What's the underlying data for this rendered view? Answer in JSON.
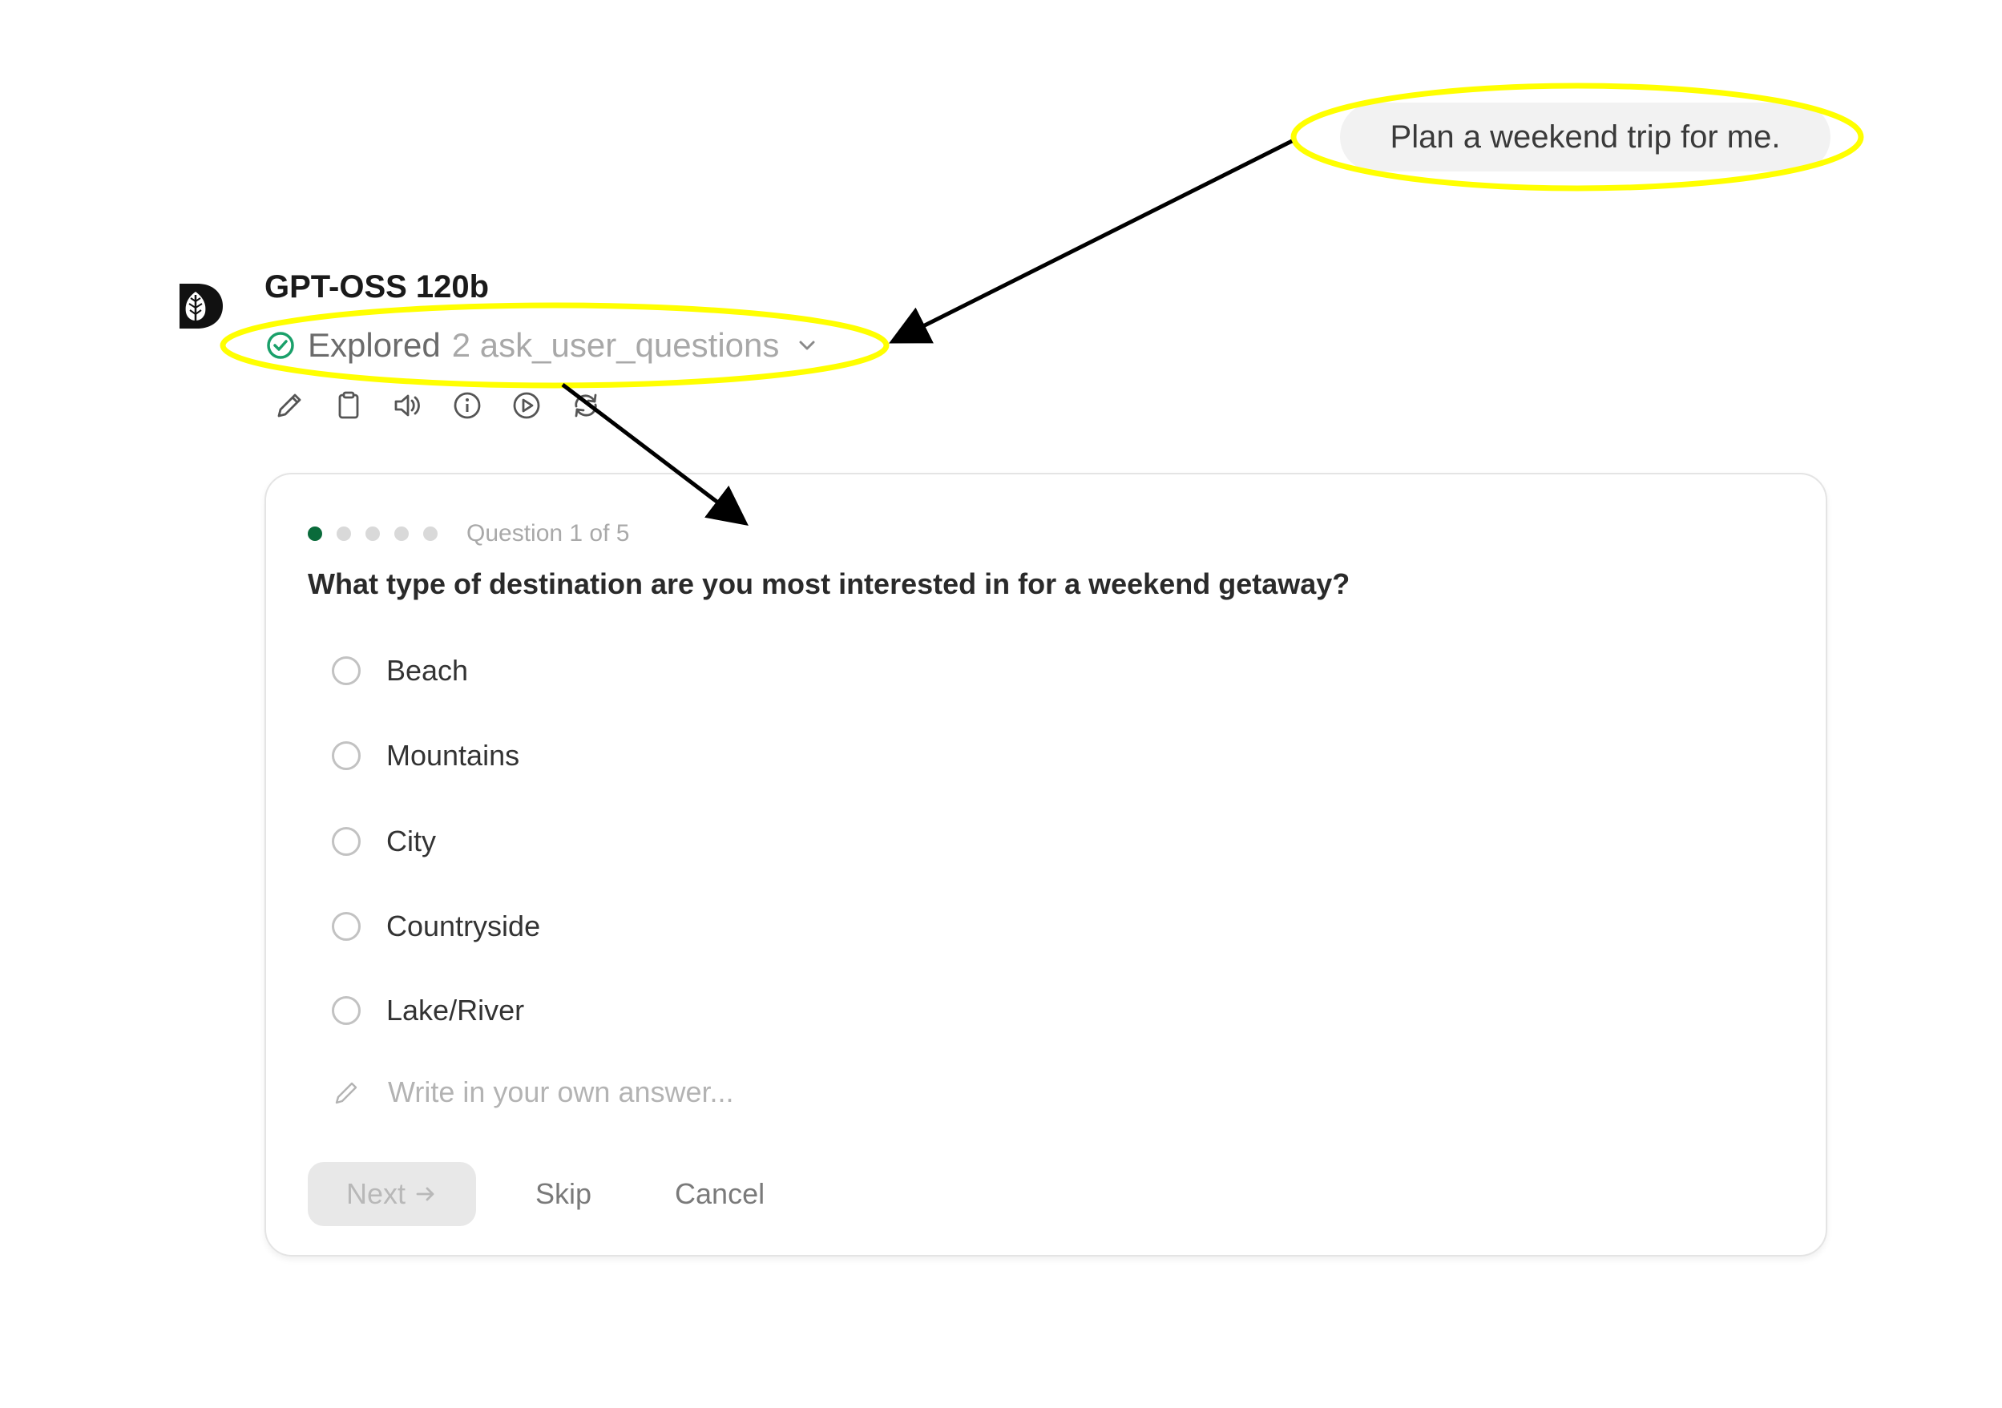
{
  "user_message": "Plan a weekend trip for me.",
  "model": {
    "name": "GPT-OSS 120b",
    "status_label": "Explored",
    "status_detail": "2 ask_user_questions",
    "toolbar_icons": [
      "pencil-icon",
      "clipboard-icon",
      "speaker-icon",
      "info-icon",
      "play-icon",
      "refresh-icon"
    ]
  },
  "question_card": {
    "total_questions": 5,
    "current_question": 1,
    "progress_text": "Question 1 of 5",
    "question": "What type of destination are you most interested in for a weekend getaway?",
    "options": [
      "Beach",
      "Mountains",
      "City",
      "Countryside",
      "Lake/River"
    ],
    "own_answer_placeholder": "Write in your own answer...",
    "next_label": "Next",
    "skip_label": "Skip",
    "cancel_label": "Cancel"
  },
  "colors": {
    "highlight": "#ffff00",
    "progress_active": "#0a6b3b",
    "check": "#1aa06a"
  }
}
